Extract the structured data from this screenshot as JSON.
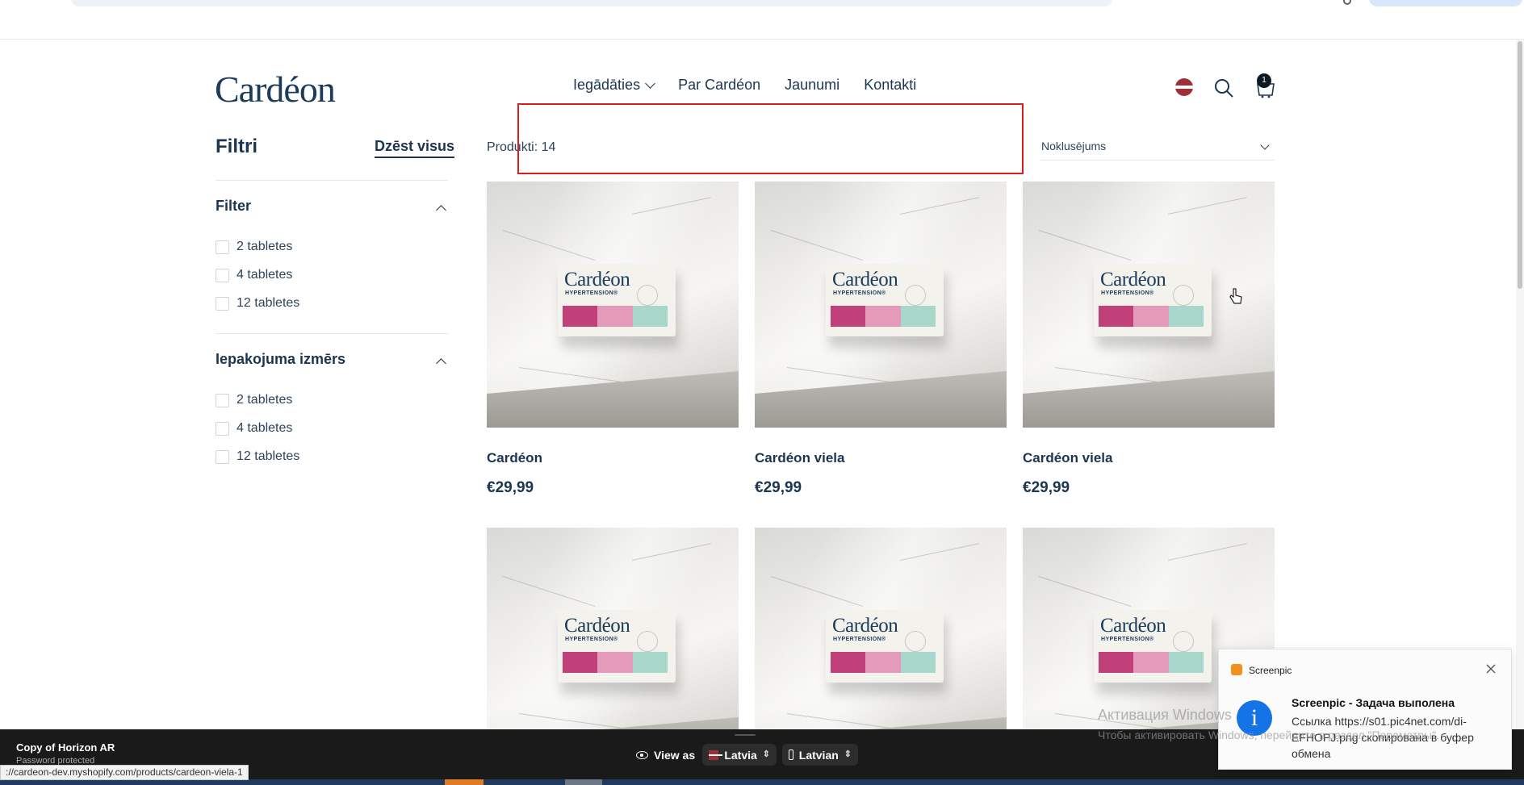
{
  "header": {
    "logo": "Cardéon",
    "nav": [
      {
        "label": "Iegādāties",
        "dropdown": true
      },
      {
        "label": "Par Cardéon"
      },
      {
        "label": "Jaunumi"
      },
      {
        "label": "Kontakti"
      }
    ],
    "cart_count": "1",
    "icons": [
      "latvia-flag-icon",
      "search-icon",
      "cart-icon"
    ]
  },
  "sidebar": {
    "title": "Filtri",
    "clear_all": "Dzēst visus",
    "groups": [
      {
        "title": "Filter",
        "options": [
          "2 tabletes",
          "4 tabletes",
          "12 tabletes"
        ]
      },
      {
        "title": "Iepakojuma izmērs",
        "options": [
          "2 tabletes",
          "4 tabletes",
          "12 tabletes"
        ]
      }
    ]
  },
  "main": {
    "product_count": "Produkti: 14",
    "sort_value": "Noklusējums",
    "products": [
      {
        "title": "Cardéon",
        "price": "€29,99"
      },
      {
        "title": "Cardéon viela",
        "price": "€29,99"
      },
      {
        "title": "Cardéon viela",
        "price": "€29,99"
      },
      {
        "title": "",
        "price": ""
      },
      {
        "title": "",
        "price": ""
      },
      {
        "title": "",
        "price": ""
      }
    ],
    "package": {
      "brand": "Cardéon",
      "subtitle": "HYPERTENSION®"
    }
  },
  "notification": {
    "app": "Screenpic",
    "title": "Screenpic - Задача выполена",
    "body": "Ссылка https://s01.pic4net.com/di-EFHOPJ.png скопирована в буфер обмена"
  },
  "watermark": {
    "line1": "Активация Windows",
    "line2": "Чтобы активировать Windows, перейдите в раздел \"Параметры\"."
  },
  "admin_bar": {
    "store_name": "Copy of Horizon AR",
    "store_status": "Password protected",
    "view_as": "View as",
    "country": "Latvia",
    "language": "Latvian"
  },
  "status_url": "://cardeon-dev.myshopify.com/products/cardeon-viela-1",
  "colors": {
    "brand": "#1c3550",
    "highlight": "#d81e1e",
    "admin_bar": "#1a1a1a"
  }
}
